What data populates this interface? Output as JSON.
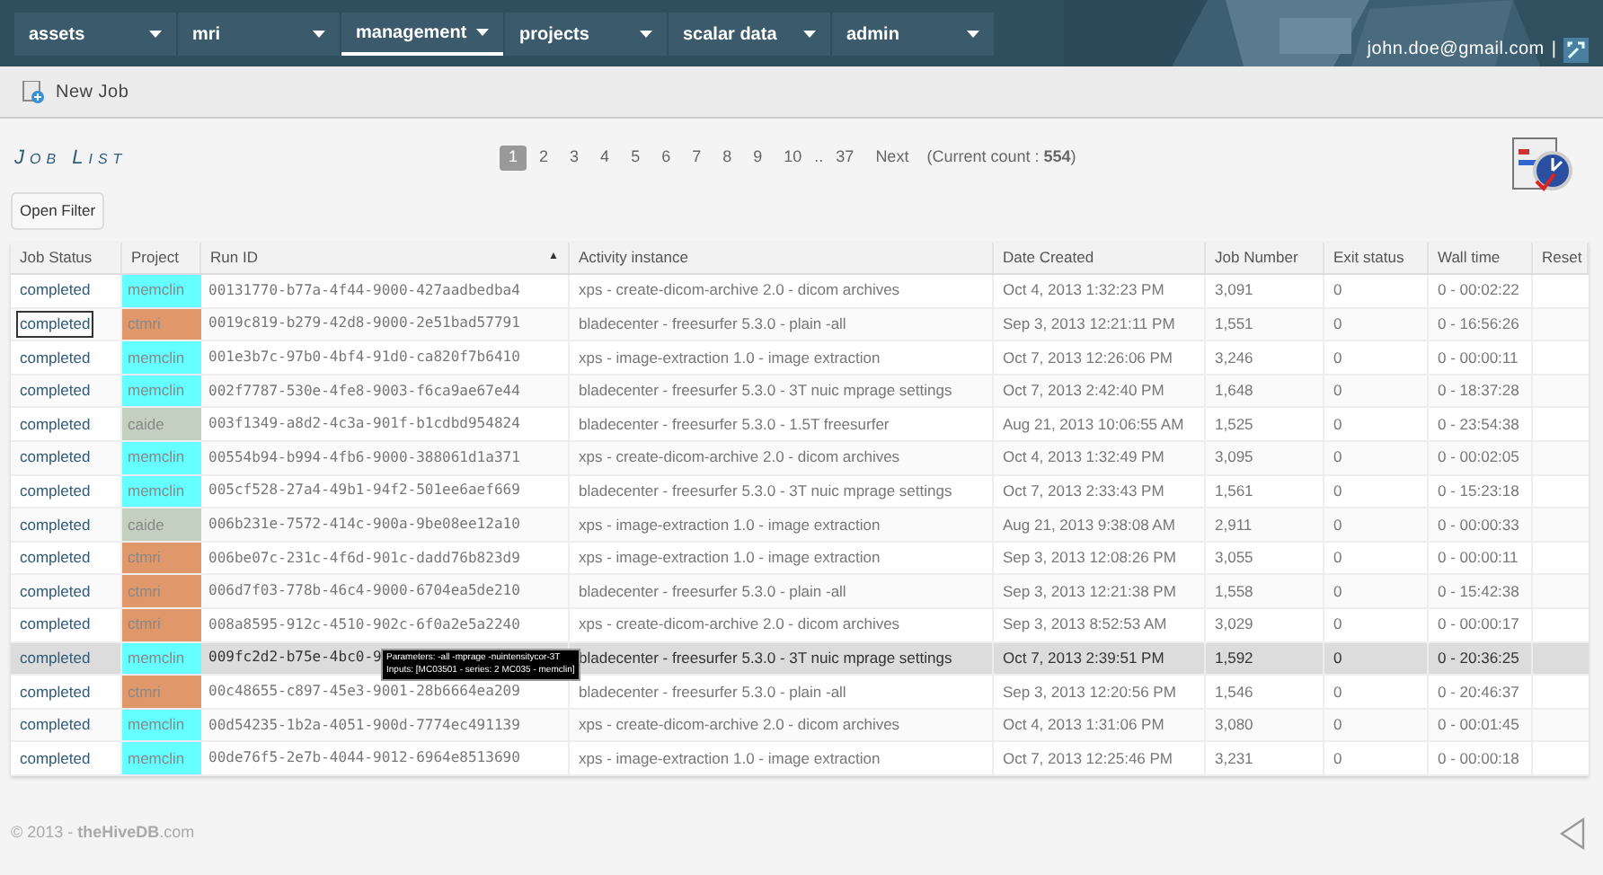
{
  "nav": [
    {
      "label": "assets",
      "selected": false
    },
    {
      "label": "mri",
      "selected": false
    },
    {
      "label": "management",
      "selected": true
    },
    {
      "label": "projects",
      "selected": false
    },
    {
      "label": "scalar data",
      "selected": false
    },
    {
      "label": "admin",
      "selected": false
    }
  ],
  "user": {
    "email": "john.doe@gmail.com",
    "separator": "|"
  },
  "toolbar": {
    "new_job": "New Job"
  },
  "title": "Job List",
  "pagination": {
    "pages": [
      {
        "label": "1",
        "selected": true
      },
      {
        "label": "2",
        "selected": false
      },
      {
        "label": "3",
        "selected": false
      },
      {
        "label": "4",
        "selected": false
      },
      {
        "label": "5",
        "selected": false
      },
      {
        "label": "6",
        "selected": false
      },
      {
        "label": "7",
        "selected": false
      },
      {
        "label": "8",
        "selected": false
      },
      {
        "label": "9",
        "selected": false
      },
      {
        "label": "10",
        "selected": false
      }
    ],
    "ellipsis": "..",
    "last": "37",
    "next": "Next",
    "count": "(Current count : **554**)"
  },
  "open_filter": "Open Filter",
  "table": {
    "columns": [
      "Job Status",
      "Project",
      "Run ID",
      "Activity instance",
      "Date Created",
      "Job Number",
      "Exit status",
      "Wall time",
      "Reset"
    ],
    "sort_indicator": "▲",
    "rows": [
      {
        "status": "completed",
        "focused": false,
        "highlighted": false,
        "project": "memclin",
        "color": "#66ffff",
        "run_id": "00131770-b77a-4f44-9000-427aadbedba4",
        "activity": "xps - create-dicom-archive 2.0 - dicom archives",
        "date": "Oct 4, 2013 1:32:23 PM",
        "job_number": "3,091",
        "exit": "0",
        "wall": "0 - 00:02:22"
      },
      {
        "status": "completed",
        "focused": true,
        "highlighted": false,
        "project": "ctmri",
        "color": "#e0976a",
        "run_id": "0019c819-b279-42d8-9000-2e51bad57791",
        "activity": "bladecenter - freesurfer 5.3.0 - plain -all",
        "date": "Sep 3, 2013 12:21:11 PM",
        "job_number": "1,551",
        "exit": "0",
        "wall": "0 - 16:56:26"
      },
      {
        "status": "completed",
        "focused": false,
        "highlighted": false,
        "project": "memclin",
        "color": "#66ffff",
        "run_id": "001e3b7c-97b0-4bf4-91d0-ca820f7b6410",
        "activity": "xps - image-extraction 1.0 - image extraction",
        "date": "Oct 7, 2013 12:26:06 PM",
        "job_number": "3,246",
        "exit": "0",
        "wall": "0 - 00:00:11"
      },
      {
        "status": "completed",
        "focused": false,
        "highlighted": false,
        "project": "memclin",
        "color": "#66ffff",
        "run_id": "002f7787-530e-4fe8-9003-f6ca9ae67e44",
        "activity": "bladecenter - freesurfer 5.3.0 - 3T nuic mprage settings",
        "date": "Oct 7, 2013 2:42:40 PM",
        "job_number": "1,648",
        "exit": "0",
        "wall": "0 - 18:37:28"
      },
      {
        "status": "completed",
        "focused": false,
        "highlighted": false,
        "project": "caide",
        "color": "#c3cfbf",
        "run_id": "003f1349-a8d2-4c3a-901f-b1cdbd954824",
        "activity": "bladecenter - freesurfer 5.3.0 - 1.5T freesurfer",
        "date": "Aug 21, 2013 10:06:55 AM",
        "job_number": "1,525",
        "exit": "0",
        "wall": "0 - 23:54:38"
      },
      {
        "status": "completed",
        "focused": false,
        "highlighted": false,
        "project": "memclin",
        "color": "#66ffff",
        "run_id": "00554b94-b994-4fb6-9000-388061d1a371",
        "activity": "xps - create-dicom-archive 2.0 - dicom archives",
        "date": "Oct 4, 2013 1:32:49 PM",
        "job_number": "3,095",
        "exit": "0",
        "wall": "0 - 00:02:05"
      },
      {
        "status": "completed",
        "focused": false,
        "highlighted": false,
        "project": "memclin",
        "color": "#66ffff",
        "run_id": "005cf528-27a4-49b1-94f2-501ee6aef669",
        "activity": "bladecenter - freesurfer 5.3.0 - 3T nuic mprage settings",
        "date": "Oct 7, 2013 2:33:43 PM",
        "job_number": "1,561",
        "exit": "0",
        "wall": "0 - 15:23:18"
      },
      {
        "status": "completed",
        "focused": false,
        "highlighted": false,
        "project": "caide",
        "color": "#c3cfbf",
        "run_id": "006b231e-7572-414c-900a-9be08ee12a10",
        "activity": "xps - image-extraction 1.0 - image extraction",
        "date": "Aug 21, 2013 9:38:08 AM",
        "job_number": "2,911",
        "exit": "0",
        "wall": "0 - 00:00:33"
      },
      {
        "status": "completed",
        "focused": false,
        "highlighted": false,
        "project": "ctmri",
        "color": "#e0976a",
        "run_id": "006be07c-231c-4f6d-901c-dadd76b823d9",
        "activity": "xps - image-extraction 1.0 - image extraction",
        "date": "Sep 3, 2013 12:08:26 PM",
        "job_number": "3,055",
        "exit": "0",
        "wall": "0 - 00:00:11"
      },
      {
        "status": "completed",
        "focused": false,
        "highlighted": false,
        "project": "ctmri",
        "color": "#e0976a",
        "run_id": "006d7f03-778b-46c4-9000-6704ea5de210",
        "activity": "bladecenter - freesurfer 5.3.0 - plain -all",
        "date": "Sep 3, 2013 12:21:38 PM",
        "job_number": "1,558",
        "exit": "0",
        "wall": "0 - 15:42:38"
      },
      {
        "status": "completed",
        "focused": false,
        "highlighted": false,
        "project": "ctmri",
        "color": "#e0976a",
        "run_id": "008a8595-912c-4510-902c-6f0a2e5a2240",
        "activity": "xps - create-dicom-archive 2.0 - dicom archives",
        "date": "Sep 3, 2013 8:52:53 AM",
        "job_number": "3,029",
        "exit": "0",
        "wall": "0 - 00:00:17"
      },
      {
        "status": "completed",
        "focused": false,
        "highlighted": true,
        "project": "memclin",
        "color": "#66ffff",
        "run_id": "009fc2d2-b75e-4bc0-9",
        "activity": "bladecenter - freesurfer 5.3.0 - 3T nuic mprage settings",
        "date": "Oct 7, 2013 2:39:51 PM",
        "job_number": "1,592",
        "exit": "0",
        "wall": "0 - 20:36:25",
        "tooltip": [
          "Parameters: -all -mprage -nuintensitycor-3T",
          "Inputs: [MC03501 - series: 2 MC035 - memclin]"
        ]
      },
      {
        "status": "completed",
        "focused": false,
        "highlighted": false,
        "project": "ctmri",
        "color": "#e0976a",
        "run_id": "00c48655-c897-45e3-9001-28b6664ea209",
        "activity": "bladecenter - freesurfer 5.3.0 - plain -all",
        "date": "Sep 3, 2013 12:20:56 PM",
        "job_number": "1,546",
        "exit": "0",
        "wall": "0 - 20:46:37"
      },
      {
        "status": "completed",
        "focused": false,
        "highlighted": false,
        "project": "memclin",
        "color": "#66ffff",
        "run_id": "00d54235-1b2a-4051-900d-7774ec491139",
        "activity": "xps - create-dicom-archive 2.0 - dicom archives",
        "date": "Oct 4, 2013 1:31:06 PM",
        "job_number": "3,080",
        "exit": "0",
        "wall": "0 - 00:01:45"
      },
      {
        "status": "completed",
        "focused": false,
        "highlighted": false,
        "project": "memclin",
        "color": "#66ffff",
        "run_id": "00de76f5-2e7b-4044-9012-6964e8513690",
        "activity": "xps - image-extraction 1.0 - image extraction",
        "date": "Oct 7, 2013 12:25:46 PM",
        "job_number": "3,231",
        "exit": "0",
        "wall": "0 - 00:00:18"
      }
    ]
  },
  "footer": "© 2013 - **theHiveDB**.com"
}
